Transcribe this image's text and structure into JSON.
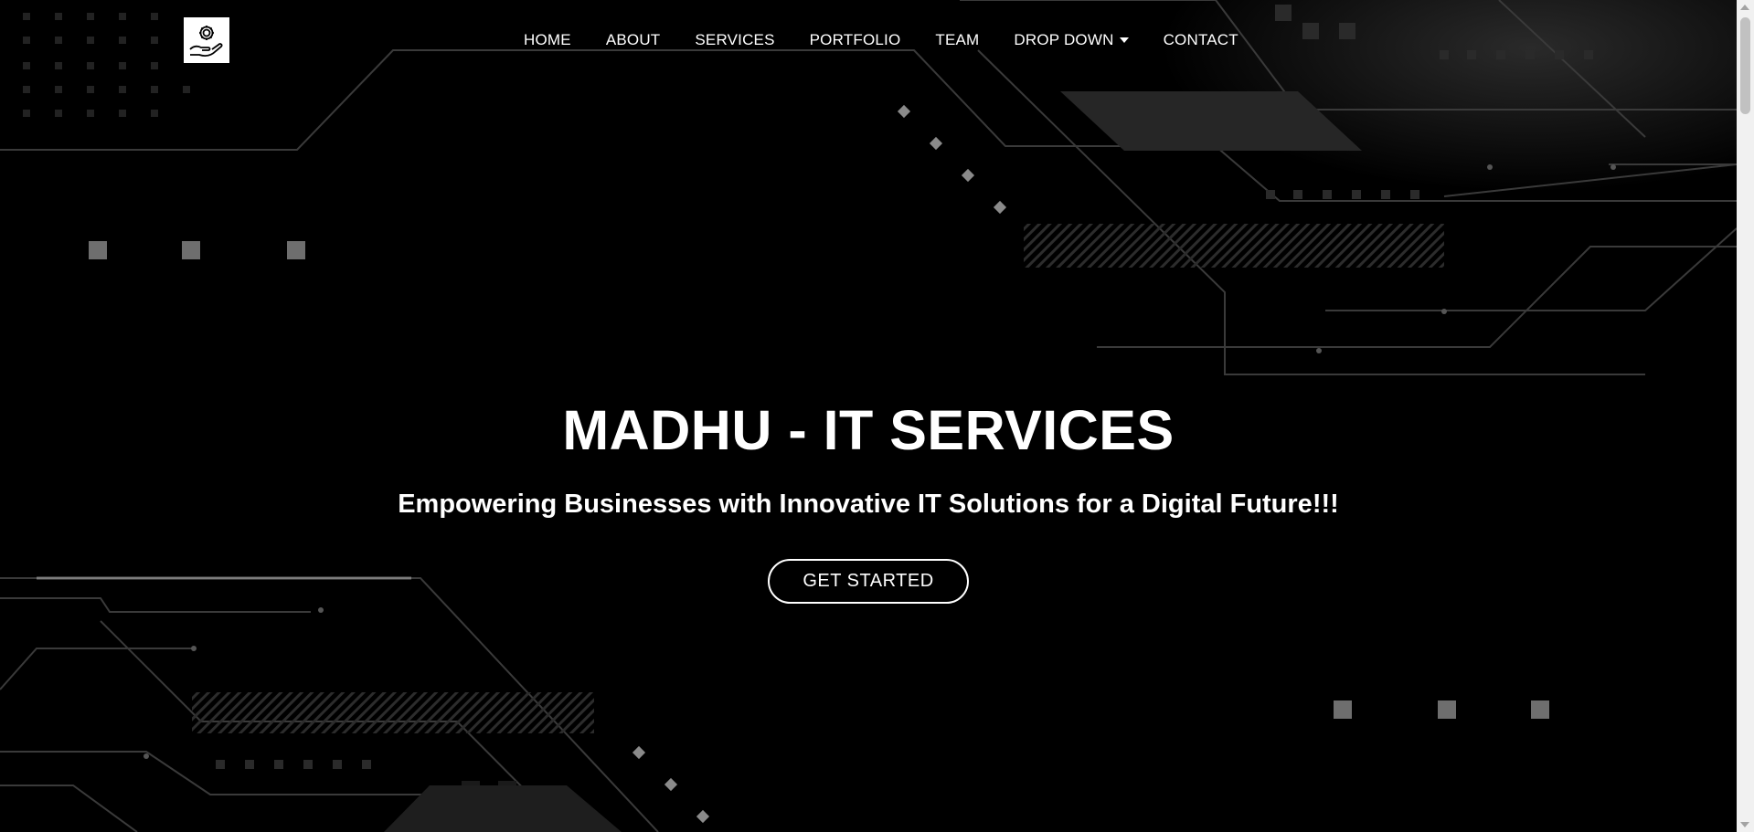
{
  "header": {
    "logo_icon": "gear-in-hand-icon",
    "nav": [
      {
        "label": "HOME"
      },
      {
        "label": "ABOUT"
      },
      {
        "label": "SERVICES"
      },
      {
        "label": "PORTFOLIO"
      },
      {
        "label": "TEAM"
      },
      {
        "label": "DROP DOWN",
        "icon": "chevron-down-icon"
      },
      {
        "label": "CONTACT"
      }
    ]
  },
  "hero": {
    "title": "MADHU - IT SERVICES",
    "subtitle": "Empowering Businesses with Innovative IT Solutions for a Digital Future!!!",
    "cta_label": "GET STARTED"
  },
  "colors": {
    "background": "#000000",
    "text": "#ffffff",
    "circuit": "#3a3a3a"
  }
}
